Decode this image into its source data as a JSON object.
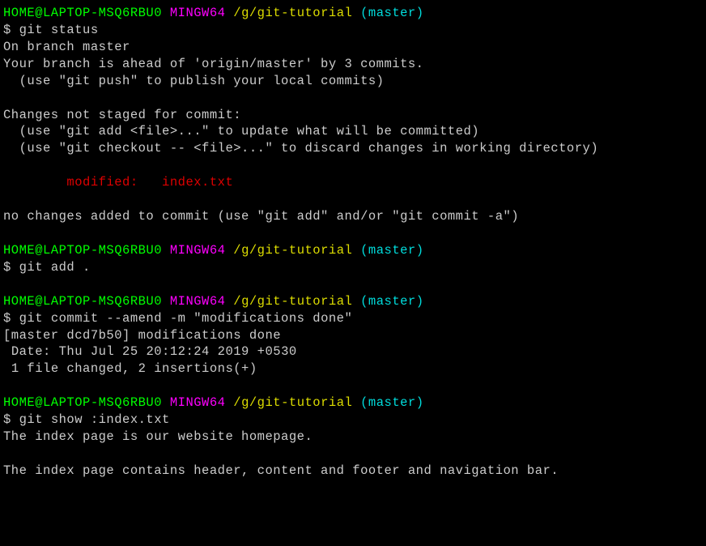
{
  "prompt": {
    "user_host": "HOME@LAPTOP-MSQ6RBU0",
    "shell": "MINGW64",
    "path": "/g/git-tutorial",
    "branch": "(master)",
    "symbol": "$ "
  },
  "block1": {
    "cmd": "git status",
    "l1": "On branch master",
    "l2": "Your branch is ahead of 'origin/master' by 3 commits.",
    "l3": "  (use \"git push\" to publish your local commits)",
    "l4": "Changes not staged for commit:",
    "l5": "  (use \"git add <file>...\" to update what will be committed)",
    "l6": "  (use \"git checkout -- <file>...\" to discard changes in working directory)",
    "l7": "        modified:   index.txt",
    "l8": "no changes added to commit (use \"git add\" and/or \"git commit -a\")"
  },
  "block2": {
    "cmd": "git add ."
  },
  "block3": {
    "cmd": "git commit --amend -m \"modifications done\"",
    "l1": "[master dcd7b50] modifications done",
    "l2": " Date: Thu Jul 25 20:12:24 2019 +0530",
    "l3": " 1 file changed, 2 insertions(+)"
  },
  "block4": {
    "cmd": "git show :index.txt",
    "l1": "The index page is our website homepage.",
    "l2": "The index page contains header, content and footer and navigation bar."
  }
}
